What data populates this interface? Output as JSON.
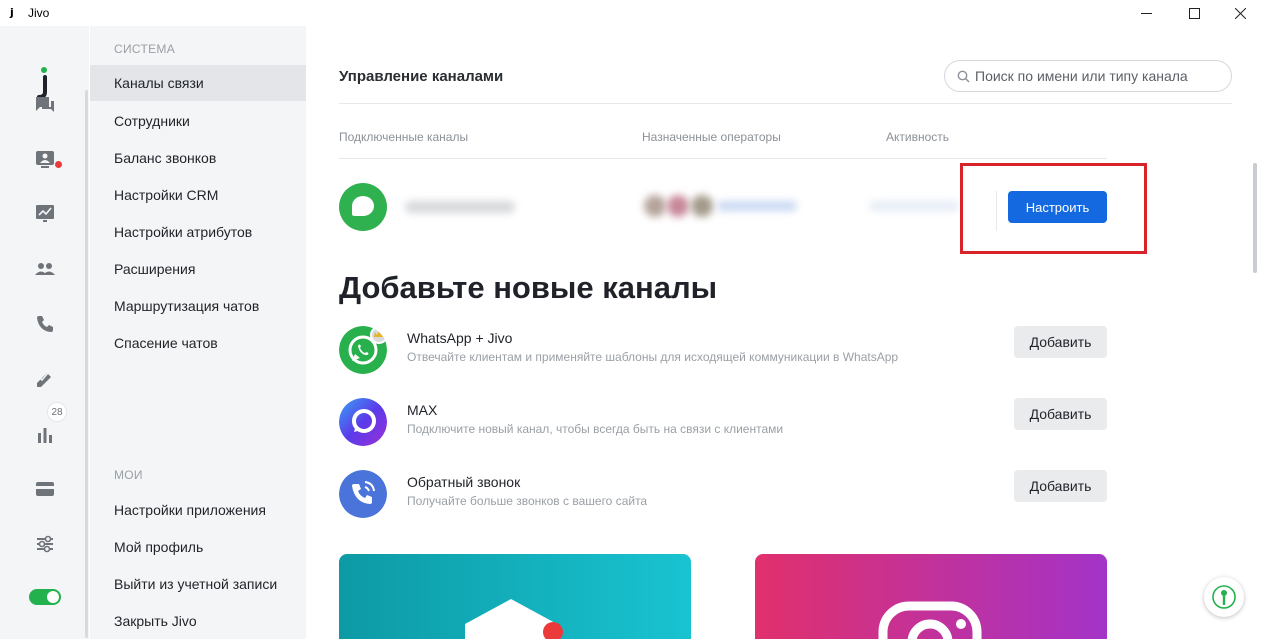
{
  "window": {
    "app_logo": "j",
    "title": "Jivo"
  },
  "rail": {
    "icons": [
      "chat-icon",
      "visitors-icon",
      "dashboard-icon",
      "team-icon",
      "phone-icon",
      "tasks-icon",
      "stats-icon",
      "billing-icon",
      "settings-icon"
    ],
    "tasks_badge": "28",
    "colors": {
      "logo_green": "#22b14c",
      "toggle_on": "#22b14c",
      "notification": "#ea3a3a"
    }
  },
  "sidebar": {
    "section_system": "СИСТЕМА",
    "system_items": [
      {
        "label": "Каналы связи",
        "active": true
      },
      {
        "label": "Сотрудники"
      },
      {
        "label": "Баланс звонков"
      },
      {
        "label": "Настройки CRM"
      },
      {
        "label": "Настройки атрибутов"
      },
      {
        "label": "Расширения"
      },
      {
        "label": "Маршрутизация чатов"
      },
      {
        "label": "Спасение чатов"
      }
    ],
    "section_my": "МОИ",
    "my_items": [
      {
        "label": "Настройки приложения"
      },
      {
        "label": "Мой профиль"
      },
      {
        "label": "Выйти из учетной записи"
      },
      {
        "label": "Закрыть Jivo"
      }
    ]
  },
  "main": {
    "title": "Управление каналами",
    "search_placeholder": "Поиск по имени или типу канала",
    "columns": [
      "Подключенные каналы",
      "Назначенные операторы",
      "Активность"
    ],
    "configure_label": "Настроить",
    "add_title": "Добавьте новые каналы",
    "add_channels": [
      {
        "name": "WhatsApp + Jivo",
        "description": "Отвечайте клиентам и применяйте шаблоны для исходящей коммуникации в WhatsApp",
        "button": "Добавить"
      },
      {
        "name": "MAX",
        "description": "Подключите новый канал, чтобы всегда быть на связи с клиентами",
        "button": "Добавить"
      },
      {
        "name": "Обратный звонок",
        "description": "Получайте больше звонков с вашего сайта",
        "button": "Добавить"
      }
    ],
    "colors": {
      "primary": "#1469e0",
      "highlight_frame": "#d8232a"
    }
  }
}
